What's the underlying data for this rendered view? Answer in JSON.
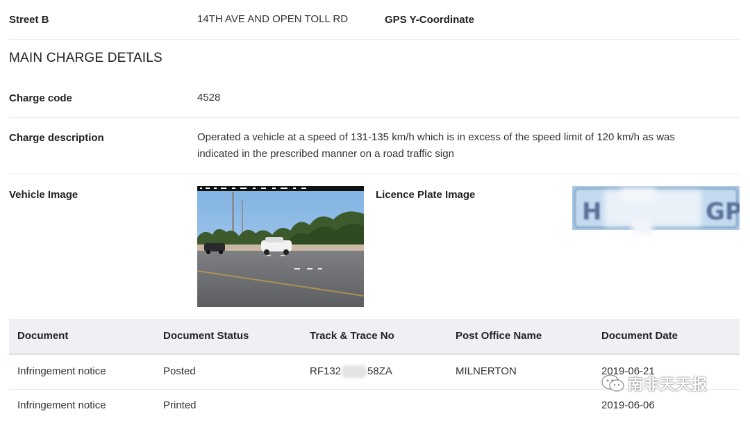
{
  "street_b": {
    "label": "Street B",
    "value": "14TH AVE AND OPEN TOLL RD"
  },
  "gps_y": {
    "label": "GPS Y-Coordinate"
  },
  "section": {
    "title": "MAIN CHARGE DETAILS"
  },
  "charge_code": {
    "label": "Charge code",
    "value": "4528"
  },
  "charge_description": {
    "label": "Charge description",
    "line1": "Operated a vehicle at a speed of 131-135 km/h which is in excess of the speed limit of 120 km/h as was",
    "line2": "indicated in the prescribed manner on a road traffic sign"
  },
  "vehicle_image": {
    "label": "Vehicle Image"
  },
  "licence_plate_image": {
    "label": "Licence Plate Image",
    "plate_left": "H",
    "plate_right": "GP"
  },
  "documents": {
    "headers": [
      "Document",
      "Document Status",
      "Track & Trace No",
      "Post Office Name",
      "Document Date"
    ],
    "rows": [
      {
        "document": "Infringement notice",
        "status": "Posted",
        "track_prefix": "RF132",
        "track_suffix": "58ZA",
        "post_office": "MILNERTON",
        "date": "2019-06-21"
      },
      {
        "document": "Infringement notice",
        "status": "Printed",
        "track_prefix": "",
        "track_suffix": "",
        "post_office": "",
        "date": "2019-06-06"
      }
    ]
  },
  "watermark": {
    "text": "南非天天报"
  }
}
